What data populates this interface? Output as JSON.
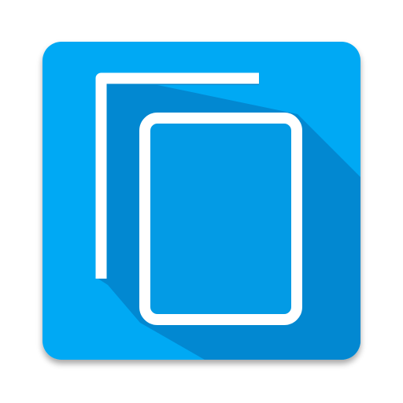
{
  "app_icon": {
    "name": "copy-icon",
    "glyph": "two-overlapping-pages",
    "colors": {
      "tile": "#03A9F4",
      "tile_shadow": "#9E9E9E",
      "long_shadow": "#0288D1",
      "page_fill": "#039BE5",
      "stroke": "#FFFFFF",
      "background": "#FFFFFF"
    }
  }
}
